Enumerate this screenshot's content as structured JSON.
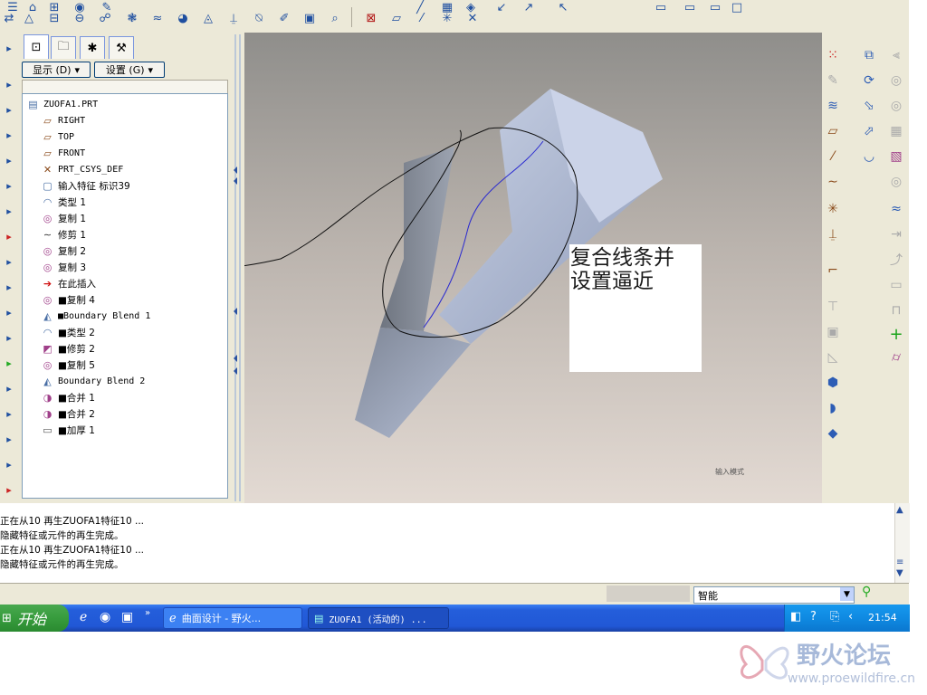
{
  "navigator": {
    "show_menu": "显示 (D)",
    "settings_menu": "设置 (G)",
    "tree": [
      {
        "label": "ZUOFA1.PRT",
        "icon": "part-icon"
      },
      {
        "label": "RIGHT",
        "icon": "datum-plane-icon"
      },
      {
        "label": "TOP",
        "icon": "datum-plane-icon"
      },
      {
        "label": "FRONT",
        "icon": "datum-plane-icon"
      },
      {
        "label": "PRT_CSYS_DEF",
        "icon": "csys-icon"
      },
      {
        "label": "输入特征 标识39",
        "icon": "import-feature-icon"
      },
      {
        "label": "类型 1",
        "icon": "surface-icon"
      },
      {
        "label": "复制 1",
        "icon": "copy-surface-icon"
      },
      {
        "label": "修剪 1",
        "icon": "trim-curve-icon"
      },
      {
        "label": "复制 2",
        "icon": "copy-surface-icon"
      },
      {
        "label": "复制 3",
        "icon": "copy-surface-icon"
      },
      {
        "label": "在此插入",
        "icon": "insert-here-arrow-icon"
      },
      {
        "label": "■复制 4",
        "icon": "copy-surface-icon"
      },
      {
        "label": "■Boundary Blend 1",
        "icon": "boundary-blend-icon"
      },
      {
        "label": "■类型 2",
        "icon": "surface-icon"
      },
      {
        "label": "■修剪 2",
        "icon": "trim-surface-icon"
      },
      {
        "label": "■复制 5",
        "icon": "copy-surface-icon"
      },
      {
        "label": "Boundary Blend 2",
        "icon": "boundary-blend-icon"
      },
      {
        "label": "■合并 1",
        "icon": "merge-icon"
      },
      {
        "label": "■合并 2",
        "icon": "merge-icon"
      },
      {
        "label": "■加厚 1",
        "icon": "thicken-icon"
      }
    ]
  },
  "graphics": {
    "annotation": "复合线条并\n设置逼近",
    "mode_label": "输入模式"
  },
  "messages": [
    "正在从10 再生ZUOFA1特征10 ...",
    "隐藏特征或元件的再生完成。",
    "正在从10 再生ZUOFA1特征10 ...",
    "隐藏特征或元件的再生完成。"
  ],
  "status": {
    "filter_value": "智能"
  },
  "taskbar": {
    "start_label": "开始",
    "task1": "曲面设计 - 野火...",
    "task2": "ZUOFA1 (活动的) ...",
    "clock": "21:54"
  },
  "watermark": {
    "title": "野火论坛",
    "url": "www.proewildfire.cn"
  },
  "colors": {
    "taskbar_blue": "#245edb",
    "start_green": "#379c3d",
    "surface_blue": "#b3bfd9"
  }
}
